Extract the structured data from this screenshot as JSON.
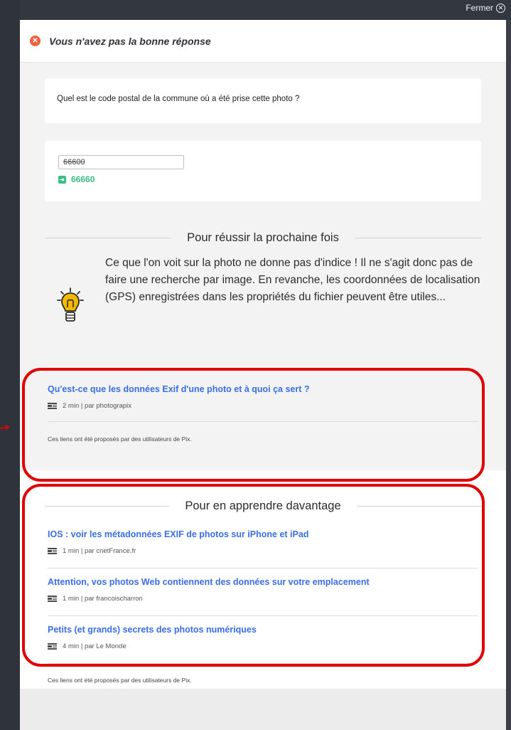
{
  "close": {
    "label": "Fermer",
    "icon": "close-circle-icon"
  },
  "header": {
    "title": "Vous n'avez pas la bonne réponse",
    "icon": "error-x-icon"
  },
  "question": {
    "text": "Quel est le code postal de la commune où a été prise cette photo ?"
  },
  "answer": {
    "given": "66600",
    "correct": "66660",
    "correct_icon": "arrow-right-icon"
  },
  "tips": {
    "title": "Pour réussir la prochaine fois",
    "icon": "lightbulb-icon",
    "text": "Ce que l'on voit sur la photo ne donne pas d'indice ! Il ne s'agit donc pas de faire une recherche par image. En revanche, les coordonnées de localisation (GPS) enregistrées dans les propriétés du fichier peuvent être utiles...",
    "resources": [
      {
        "title": "Qu'est-ce que les données Exif d'une photo et à quoi ça sert ?",
        "meta": "2 min | par photograpix"
      }
    ],
    "note": "Ces liens ont été proposés par des utilisateurs de Pix."
  },
  "learn_more": {
    "title": "Pour en apprendre davantage",
    "resources": [
      {
        "title": "IOS : voir les métadonnées EXIF de photos sur iPhone et iPad",
        "meta": "1 min | par cnetFrance.fr"
      },
      {
        "title": "Attention, vos photos Web contiennent des données sur votre emplacement",
        "meta": "1 min | par francoischarron"
      },
      {
        "title": "Petits (et grands) secrets des photos numériques",
        "meta": "4 min | par Le Monde"
      }
    ],
    "note": "Ces liens ont été proposés par des utilisateurs de Pix."
  },
  "colors": {
    "link": "#3a6ee6",
    "correct": "#3dbb84",
    "error": "#f0623d",
    "highlight": "#e30000",
    "lightbulb": "#f5b800"
  }
}
